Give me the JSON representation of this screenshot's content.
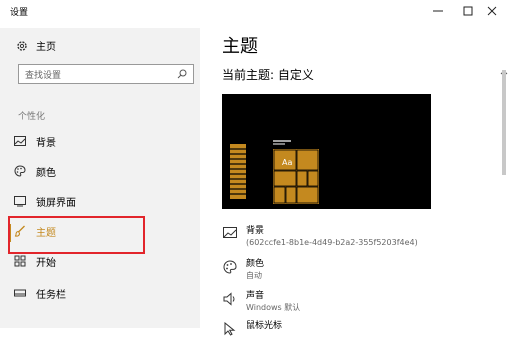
{
  "window": {
    "title": "设置"
  },
  "sidebar": {
    "home_label": "主页",
    "search_placeholder": "查找设置",
    "section_label": "个性化",
    "items": [
      {
        "label": "背景",
        "icon": "image-icon"
      },
      {
        "label": "颜色",
        "icon": "palette-icon"
      },
      {
        "label": "锁屏界面",
        "icon": "lock-screen-icon"
      },
      {
        "label": "主题",
        "icon": "brush-icon",
        "selected": true
      },
      {
        "label": "开始",
        "icon": "start-icon"
      },
      {
        "label": "任务栏",
        "icon": "taskbar-icon"
      }
    ]
  },
  "main": {
    "page_title": "主题",
    "current_theme_label": "当前主题: 自定义",
    "preview_tile_text": "Aa",
    "properties": [
      {
        "name": "背景",
        "value": "(602ccfe1-8b1e-4d49-b2a2-355f5203f4e4)",
        "icon": "image-icon"
      },
      {
        "name": "颜色",
        "value": "自动",
        "icon": "palette-icon"
      },
      {
        "name": "声音",
        "value": "Windows 默认",
        "icon": "speaker-icon"
      },
      {
        "name": "鼠标光标",
        "value": "",
        "icon": "cursor-icon"
      }
    ]
  },
  "colors": {
    "accent": "#c4891f",
    "highlight_border": "#e2252b",
    "preview_bg": "#000000",
    "sidebar_bg": "#f2f2f2"
  }
}
